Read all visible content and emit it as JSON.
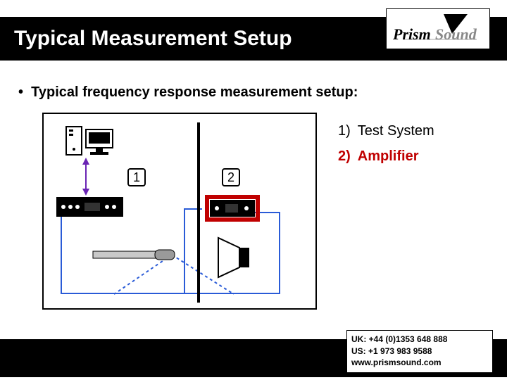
{
  "title": "Typical Measurement Setup",
  "logo": {
    "name": "Prism Sound",
    "text1": "Prism",
    "text2": "Sound"
  },
  "subtitle": "Typical frequency response measurement setup:",
  "legend": [
    {
      "num": "1)",
      "label": "Test System",
      "highlight": false
    },
    {
      "num": "2)",
      "label": "Amplifier",
      "highlight": true
    }
  ],
  "diagram": {
    "callouts": {
      "one": "1",
      "two": "2"
    }
  },
  "footer": {
    "uk": "UK: +44 (0)1353 648 888",
    "us": "US: +1 973 983 9588",
    "url": "www.prismsound.com"
  }
}
